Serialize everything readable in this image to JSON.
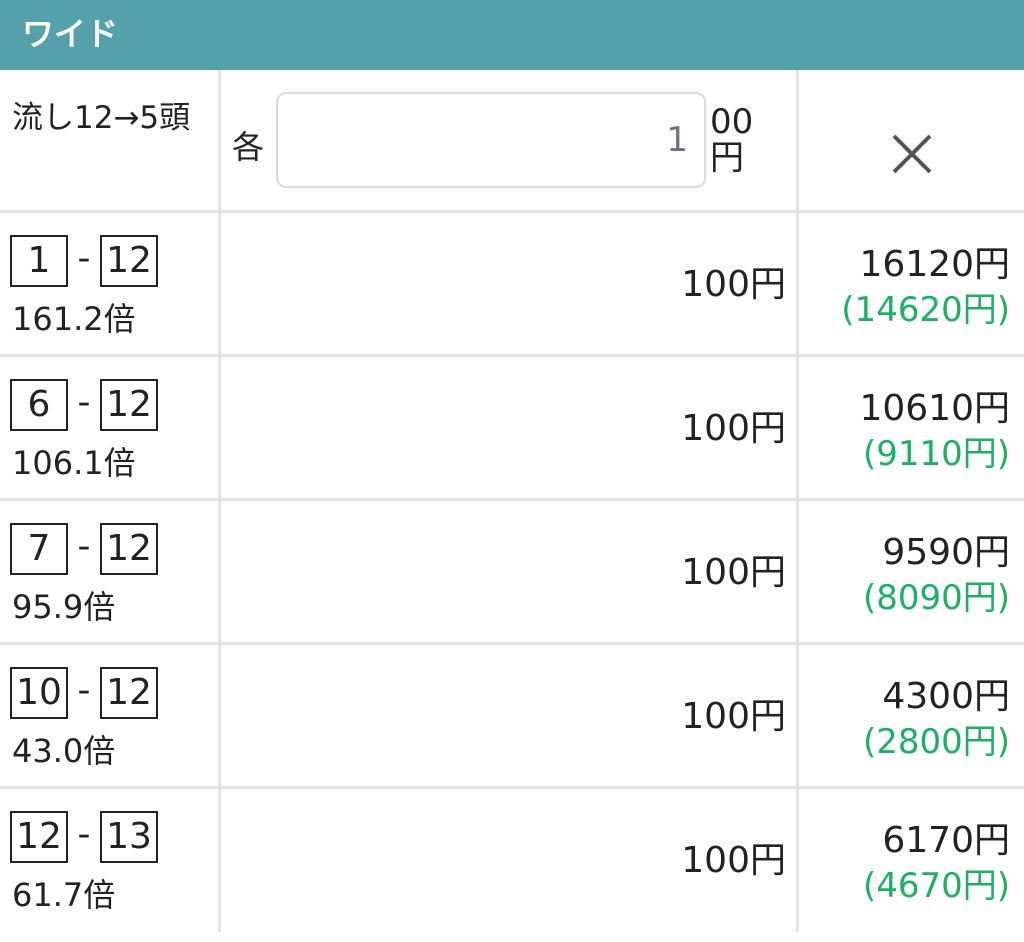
{
  "header": {
    "title": "ワイド"
  },
  "summary": {
    "label": "流し12→5頭",
    "each_label": "各",
    "amount_value": "1",
    "amount_suffix": "00円",
    "close_icon": "close-x-icon"
  },
  "bets": [
    {
      "horse_a": "1",
      "horse_b": "12",
      "dash": "-",
      "odds": "161.2倍",
      "stake": "100円",
      "payout": "16120円",
      "profit": "(14620円)"
    },
    {
      "horse_a": "6",
      "horse_b": "12",
      "dash": "-",
      "odds": "106.1倍",
      "stake": "100円",
      "payout": "10610円",
      "profit": "(9110円)"
    },
    {
      "horse_a": "7",
      "horse_b": "12",
      "dash": "-",
      "odds": "95.9倍",
      "stake": "100円",
      "payout": "9590円",
      "profit": "(8090円)"
    },
    {
      "horse_a": "10",
      "horse_b": "12",
      "dash": "-",
      "odds": "43.0倍",
      "stake": "100円",
      "payout": "4300円",
      "profit": "(2800円)"
    },
    {
      "horse_a": "12",
      "horse_b": "13",
      "dash": "-",
      "odds": "61.7倍",
      "stake": "100円",
      "payout": "6170円",
      "profit": "(4670円)"
    }
  ],
  "colors": {
    "header_bg": "#55a1a9",
    "profit_green": "#1bb163",
    "border": "#e4e4e4"
  }
}
